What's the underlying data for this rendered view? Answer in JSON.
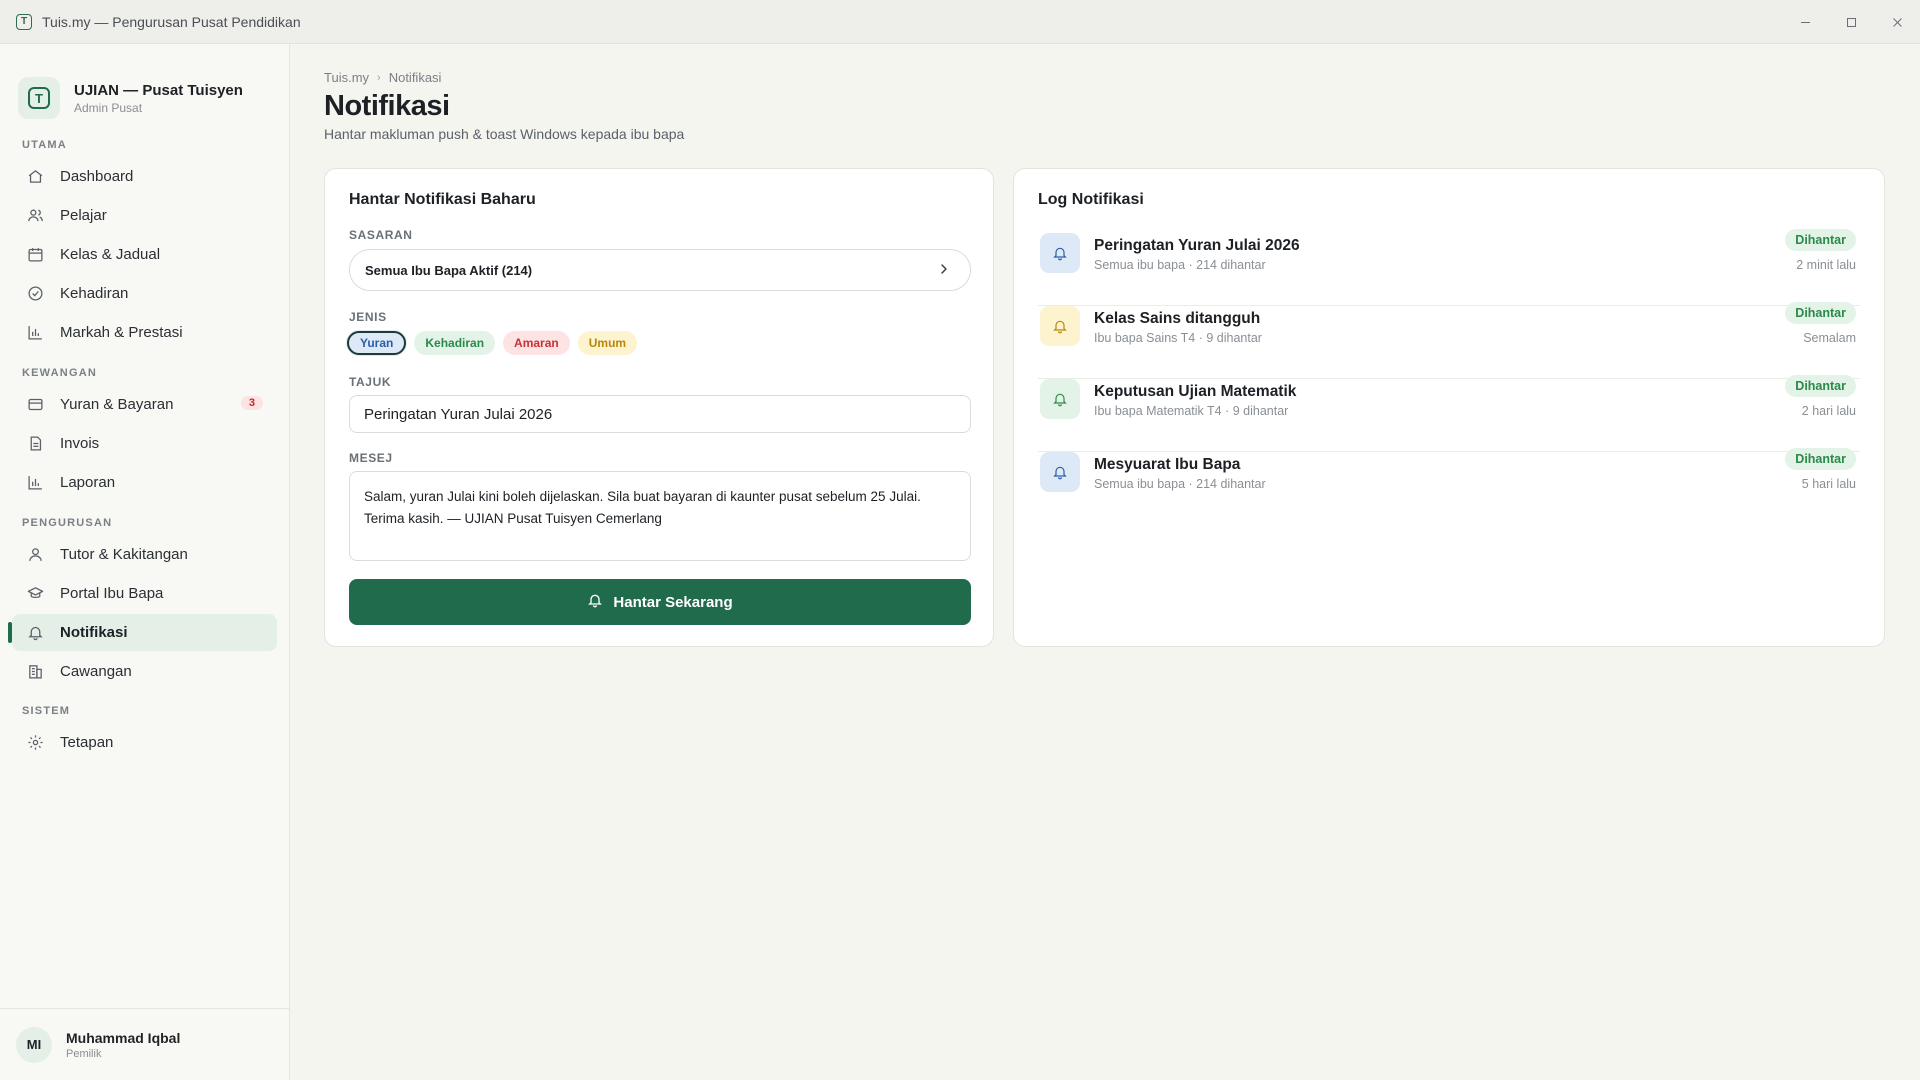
{
  "window": {
    "title": "Tuis.my — Pengurusan Pusat Pendidikan",
    "app_icon_letter": "T",
    "controls": [
      "minimize-icon",
      "maximize-icon",
      "close-icon"
    ]
  },
  "sidebar": {
    "brand": {
      "logo_letter": "T",
      "name": "UJIAN — Pusat Tuisyen",
      "sub": "Admin Pusat"
    },
    "sections": [
      {
        "label": "UTAMA"
      },
      {
        "label": "KEWANGAN"
      },
      {
        "label": "PENGURUSAN"
      },
      {
        "label": "SISTEM"
      }
    ],
    "items": [
      {
        "label": "Dashboard",
        "icon": "home-icon"
      },
      {
        "label": "Pelajar",
        "icon": "users-icon"
      },
      {
        "label": "Kelas & Jadual",
        "icon": "calendar-icon"
      },
      {
        "label": "Kehadiran",
        "icon": "check-circle-icon"
      },
      {
        "label": "Markah & Prestasi",
        "icon": "bar-chart-icon"
      },
      {
        "label": "Yuran & Bayaran",
        "icon": "credit-card-icon",
        "badge": "3"
      },
      {
        "label": "Invois",
        "icon": "document-icon"
      },
      {
        "label": "Laporan",
        "icon": "bar-chart-icon"
      },
      {
        "label": "Tutor & Kakitangan",
        "icon": "user-icon"
      },
      {
        "label": "Portal Ibu Bapa",
        "icon": "graduation-cap-icon"
      },
      {
        "label": "Notifikasi",
        "icon": "bell-icon",
        "active": true
      },
      {
        "label": "Cawangan",
        "icon": "building-icon"
      },
      {
        "label": "Tetapan",
        "icon": "gear-icon"
      }
    ],
    "user": {
      "initials": "MI",
      "name": "Muhammad Iqbal",
      "role": "Pemilik"
    }
  },
  "header": {
    "breadcrumb": [
      "Tuis.my",
      "Notifikasi"
    ],
    "title": "Notifikasi",
    "subtitle": "Hantar makluman push & toast Windows kepada ibu bapa"
  },
  "compose": {
    "title": "Hantar Notifikasi Baharu",
    "target_label": "SASARAN",
    "target_value": "Semua Ibu Bapa Aktif (214)",
    "type_label": "JENIS",
    "types": [
      {
        "label": "Yuran",
        "selected": true
      },
      {
        "label": "Kehadiran"
      },
      {
        "label": "Amaran"
      },
      {
        "label": "Umum"
      }
    ],
    "subject_label": "TAJUK",
    "subject_value": "Peringatan Yuran Julai 2026",
    "message_label": "MESEJ",
    "message_value": "Salam, yuran Julai kini boleh dijelaskan. Sila buat bayaran di kaunter pusat sebelum 25 Julai. Terima kasih. — UJIAN Pusat Tuisyen Cemerlang",
    "send_label": "Hantar Sekarang"
  },
  "log": {
    "title": "Log Notifikasi",
    "items": [
      {
        "title": "Peringatan Yuran Julai 2026",
        "meta": "Semua ibu bapa · 214 dihantar",
        "status": "Dihantar",
        "time": "2 minit lalu",
        "color": "blue"
      },
      {
        "title": "Kelas Sains ditangguh",
        "meta": "Ibu bapa Sains T4 · 9 dihantar",
        "status": "Dihantar",
        "time": "Semalam",
        "color": "yellow"
      },
      {
        "title": "Keputusan Ujian Matematik",
        "meta": "Ibu bapa Matematik T4 · 9 dihantar",
        "status": "Dihantar",
        "time": "2 hari lalu",
        "color": "green"
      },
      {
        "title": "Mesyuarat Ibu Bapa",
        "meta": "Semua ibu bapa · 214 dihantar",
        "status": "Dihantar",
        "time": "5 hari lalu",
        "color": "blue"
      }
    ]
  },
  "colors": {
    "accent": "#1f6b4b",
    "accent_soft": "#e4efe8",
    "badge_red": "#c62828",
    "status_green": "#2a8a4a"
  }
}
